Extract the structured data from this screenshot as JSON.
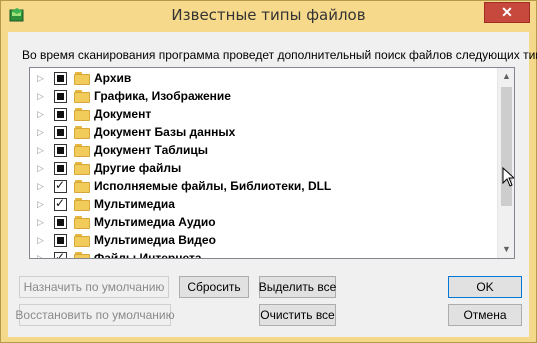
{
  "window": {
    "title": "Известные типы файлов",
    "close_symbol": "✕"
  },
  "hint": "Во время сканирования программа проведет дополнительный поиск файлов следующих типов",
  "tree": {
    "items": [
      {
        "label": "Архив",
        "state": "partial",
        "expander": "▷"
      },
      {
        "label": "Графика, Изображение",
        "state": "partial",
        "expander": "▷"
      },
      {
        "label": "Документ",
        "state": "partial",
        "expander": "▷"
      },
      {
        "label": "Документ Базы данных",
        "state": "partial",
        "expander": "▷"
      },
      {
        "label": "Документ Таблицы",
        "state": "partial",
        "expander": "▷"
      },
      {
        "label": "Другие файлы",
        "state": "partial",
        "expander": "▷"
      },
      {
        "label": "Исполняемые файлы, Библиотеки, DLL",
        "state": "checked",
        "expander": "▷"
      },
      {
        "label": "Мультимедиа",
        "state": "checked",
        "expander": "▷"
      },
      {
        "label": "Мультимедиа Аудио",
        "state": "partial",
        "expander": "▷"
      },
      {
        "label": "Мультимедиа Видео",
        "state": "partial",
        "expander": "▷"
      },
      {
        "label": "Файлы Интернета",
        "state": "checked",
        "expander": "▷"
      }
    ],
    "scroll_up": "▲",
    "scroll_down": "▼"
  },
  "buttons": {
    "set_default": "Назначить по умолчанию",
    "restore_default": "Восстановить по умолчанию",
    "reset": "Сбросить",
    "select_all": "Выделить все",
    "clear_all": "Очистить все",
    "ok": "OK",
    "cancel": "Отмена"
  },
  "colors": {
    "titlebar": "#f6d98b",
    "close": "#c7483d",
    "folder": "#f2cc5a",
    "focus": "#0078d7"
  },
  "icons": {
    "app": "shield-app-icon",
    "folder": "folder-icon"
  }
}
